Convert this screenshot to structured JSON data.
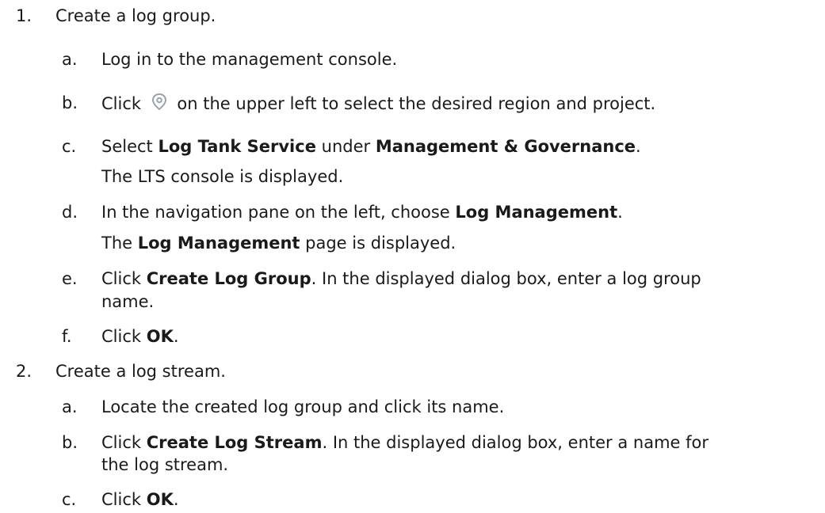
{
  "steps": [
    {
      "number": "1.",
      "title": "Create a log group.",
      "substeps": [
        {
          "letter": "a.",
          "text": "Log in to the management console."
        },
        {
          "letter": "b.",
          "pre": "Click",
          "icon": "location-pin-icon",
          "post": "on the upper left to select the desired region and project."
        },
        {
          "letter": "c.",
          "t1": "Select ",
          "b1": "Log Tank Service",
          "t2": " under ",
          "b2": "Management & Governance",
          "t3": ".",
          "note": "The LTS console is displayed."
        },
        {
          "letter": "d.",
          "t1": "In the navigation pane on the left, choose ",
          "b1": "Log Management",
          "t2": ".",
          "note_pre": "The ",
          "note_bold": "Log Management",
          "note_post": " page is displayed."
        },
        {
          "letter": "e.",
          "t1": "Click ",
          "b1": "Create Log Group",
          "t2": ". In the displayed dialog box, enter a log group",
          "cont": "name."
        },
        {
          "letter": "f.",
          "t1": "Click ",
          "b1": "OK",
          "t2": "."
        }
      ]
    },
    {
      "number": "2.",
      "title": "Create a log stream.",
      "substeps": [
        {
          "letter": "a.",
          "text": "Locate the created log group and click its name."
        },
        {
          "letter": "b.",
          "t1": "Click ",
          "b1": "Create Log Stream",
          "t2": ". In the displayed dialog box, enter a name for",
          "cont": "the log stream."
        },
        {
          "letter": "c.",
          "t1": "Click ",
          "b1": "OK",
          "t2": "."
        }
      ]
    }
  ],
  "icon_color": "#9aa3ad"
}
